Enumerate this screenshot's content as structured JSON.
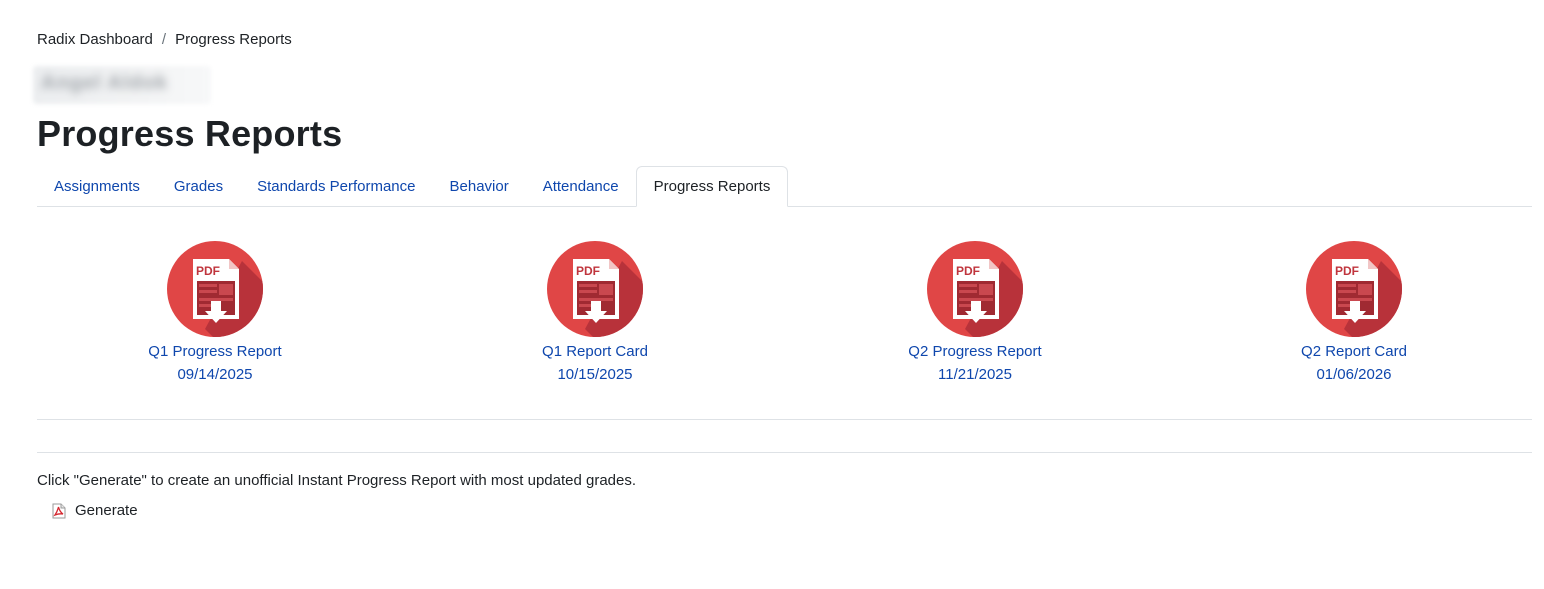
{
  "breadcrumb": {
    "home": "Radix Dashboard",
    "separator": "/",
    "current": "Progress Reports"
  },
  "student": {
    "name": "Angel Aldok"
  },
  "page": {
    "title": "Progress Reports"
  },
  "tabs": [
    {
      "label": "Assignments",
      "active": false
    },
    {
      "label": "Grades",
      "active": false
    },
    {
      "label": "Standards Performance",
      "active": false
    },
    {
      "label": "Behavior",
      "active": false
    },
    {
      "label": "Attendance",
      "active": false
    },
    {
      "label": "Progress Reports",
      "active": true
    }
  ],
  "reports": [
    {
      "label": "Q1 Progress Report",
      "date": "09/14/2025",
      "icon": "pdf-download-icon",
      "icon_text": "PDF"
    },
    {
      "label": "Q1 Report Card",
      "date": "10/15/2025",
      "icon": "pdf-download-icon",
      "icon_text": "PDF"
    },
    {
      "label": "Q2 Progress Report",
      "date": "11/21/2025",
      "icon": "pdf-download-icon",
      "icon_text": "PDF"
    },
    {
      "label": "Q2 Report Card",
      "date": "01/06/2026",
      "icon": "pdf-download-icon",
      "icon_text": "PDF"
    }
  ],
  "instant_report": {
    "instructions": "Click \"Generate\" to create an unofficial Instant Progress Report with most updated grades.",
    "generate_label": "Generate",
    "icon": "pdf-file-icon"
  },
  "colors": {
    "link": "#0f47ad",
    "text": "#1d2125",
    "border": "#dee2e6",
    "pdf_red": "#e04646",
    "pdf_shadow": "#b8323a",
    "pdf_dark": "#a02a32"
  }
}
